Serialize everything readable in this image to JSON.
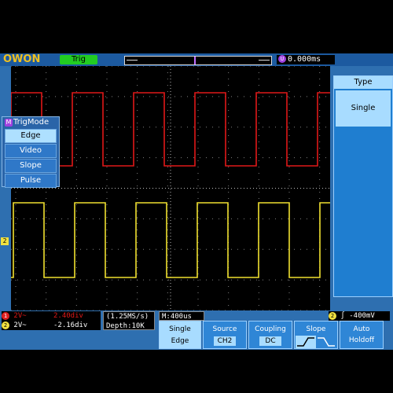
{
  "brand": {
    "logo": "OWON"
  },
  "top": {
    "trig_status": "Trig",
    "time_marker": "U",
    "time_offset": "0.000ms"
  },
  "trigmode_menu": {
    "marker": "M",
    "title": "TrigMode",
    "items": [
      "Edge",
      "Video",
      "Slope",
      "Pulse"
    ],
    "selected": "Edge"
  },
  "type_panel": {
    "title": "Type",
    "value": "Single"
  },
  "channels": {
    "ch1": {
      "badge": "1",
      "volts": "2V~",
      "position": "2.40div",
      "color": "#e01818"
    },
    "ch2": {
      "badge": "2",
      "volts": "2V~",
      "position": "-2.16div",
      "color": "#f0e030"
    }
  },
  "acquisition": {
    "sample_rate": "(1.25MS/s)",
    "depth": "Depth:10K",
    "timebase": "M:400us"
  },
  "trigger_readout": {
    "badge": "2",
    "symbol": "∫",
    "level": "-400mV"
  },
  "softkeys": [
    {
      "label": "Single",
      "value": "Edge",
      "active": true
    },
    {
      "label": "Source",
      "value": "CH2",
      "active": false
    },
    {
      "label": "Coupling",
      "value": "DC",
      "active": false
    },
    {
      "label": "Slope",
      "value": "",
      "active": false
    },
    {
      "label": "Auto",
      "value": "Holdoff",
      "active": false
    }
  ],
  "colors": {
    "frame": "#2e6fb0",
    "accent": "#a8dcff",
    "grid": "#808080"
  }
}
